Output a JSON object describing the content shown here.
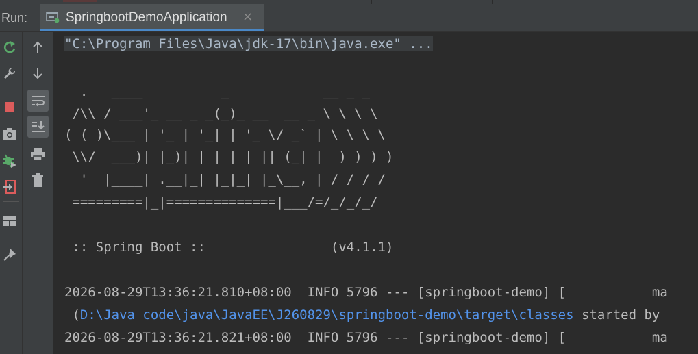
{
  "header": {
    "run_label": "Run:",
    "tab_label": "SpringbootDemoApplication",
    "tab_close": "×"
  },
  "console": {
    "command": "\"C:\\Program Files\\Java\\jdk-17\\bin\\java.exe\" ...",
    "banner": [
      "  .   ____          _            __ _ _",
      " /\\\\ / ___'_ __ _ _(_)_ __  __ _ \\ \\ \\ \\",
      "( ( )\\___ | '_ | '_| | '_ \\/ _` | \\ \\ \\ \\",
      " \\\\/  ___)| |_)| | | | | || (_| |  ) ) ) )",
      "  '  |____| .__|_| |_|_| |_\\__, | / / / /",
      " =========|_|==============|___/=/_/_/_/"
    ],
    "spring_line": " :: Spring Boot ::                (v4.1.1)",
    "log": [
      "2026-08-29T13:36:21.810+08:00  INFO 5796 --- [springboot-demo] [           ma",
      "2026-08-29T13:36:21.821+08:00  INFO 5796 --- [springboot-demo] [           ma"
    ],
    "log_cont_prefix": " (",
    "log_cont_link": "D:\\Java code\\java\\JavaEE\\J260829\\springboot-demo\\target\\classes",
    "log_cont_suffix": " started by"
  },
  "icons": {
    "left_strip": [
      "rerun-icon",
      "wrench-icon",
      "stop-icon",
      "camera-icon",
      "debug-bug-icon",
      "exit-icon",
      "layout-icon",
      "pin-icon"
    ],
    "second_strip": [
      "arrow-up-icon",
      "arrow-down-icon",
      "soft-wrap-icon",
      "scroll-to-end-icon",
      "print-icon",
      "trash-icon"
    ]
  },
  "colors": {
    "background": "#2b2b2b",
    "panel": "#3c3f41",
    "text": "#bbbbbb",
    "link": "#5394ec",
    "rerun_green": "#59a869",
    "stop_red": "#db5c5c",
    "tab_underline": "#4a88c7"
  }
}
